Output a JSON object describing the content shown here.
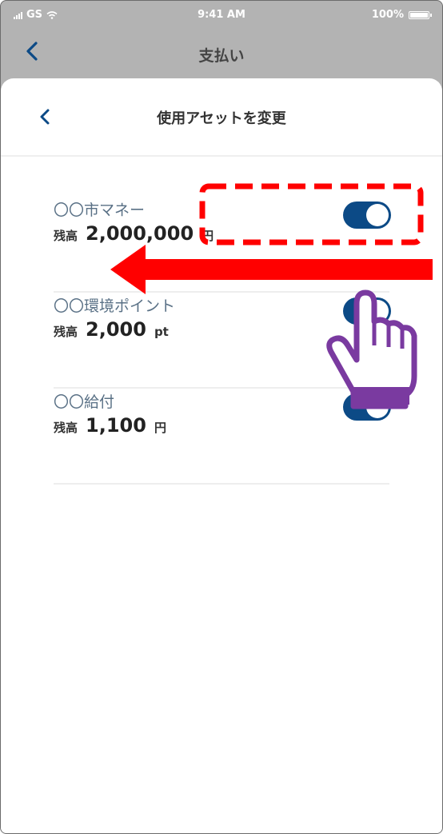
{
  "status_bar": {
    "carrier": "GS",
    "time": "9:41 AM",
    "battery": "100%"
  },
  "outer_nav": {
    "title": "支払い",
    "back_icon": "chevron-left-icon"
  },
  "sheet": {
    "title": "使用アセットを変更",
    "back_icon": "chevron-left-icon"
  },
  "balance_label": "残高",
  "assets": [
    {
      "name": "〇〇市マネー",
      "balance": "2,000,000",
      "unit": "円",
      "enabled": true
    },
    {
      "name": "〇〇環境ポイント",
      "balance": "2,000",
      "unit": "pt",
      "enabled": true
    },
    {
      "name": "〇〇給付",
      "balance": "1,100",
      "unit": "円",
      "enabled": true
    }
  ],
  "colors": {
    "accent": "#0c4a86",
    "annotation_red": "#ff0000",
    "hand_purple": "#7a3aa0",
    "dimmed_background": "#b3b3b3"
  },
  "annotation": {
    "highlight": "dashed-red-box",
    "arrow": "arrow-left",
    "pointer": "hand-pointer-icon"
  }
}
